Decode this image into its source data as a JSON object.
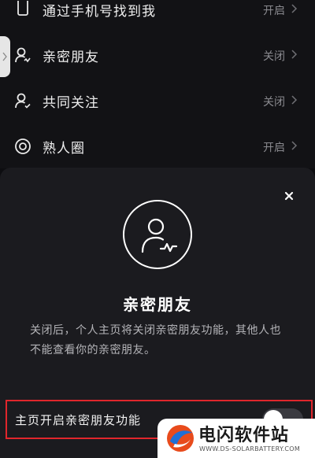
{
  "settings": {
    "items": [
      {
        "icon": "phone-icon",
        "label": "通过手机号找到我",
        "value": "开启"
      },
      {
        "icon": "person-icon",
        "label": "亲密朋友",
        "value": "关闭"
      },
      {
        "icon": "person-icon",
        "label": "共同关注",
        "value": "关闭"
      },
      {
        "icon": "circle-target-icon",
        "label": "熟人圈",
        "value": "开启"
      }
    ]
  },
  "sheet": {
    "title": "亲密朋友",
    "description": "关闭后，个人主页将关闭亲密朋友功能，其他人也不能查看你的亲密朋友。",
    "close_icon": "close-icon",
    "avatar_icon": "person-pulse-icon"
  },
  "toggle": {
    "label": "主页开启亲密朋友功能",
    "on_fraction": 0
  },
  "watermark": {
    "name": "电闪软件站",
    "url": "WWW.DS-SOLARBATTERY.COM"
  },
  "colors": {
    "background": "#121215",
    "sheet": "#1b1b1f",
    "highlight": "#e0262c",
    "muted_text": "#8a8a8f"
  }
}
